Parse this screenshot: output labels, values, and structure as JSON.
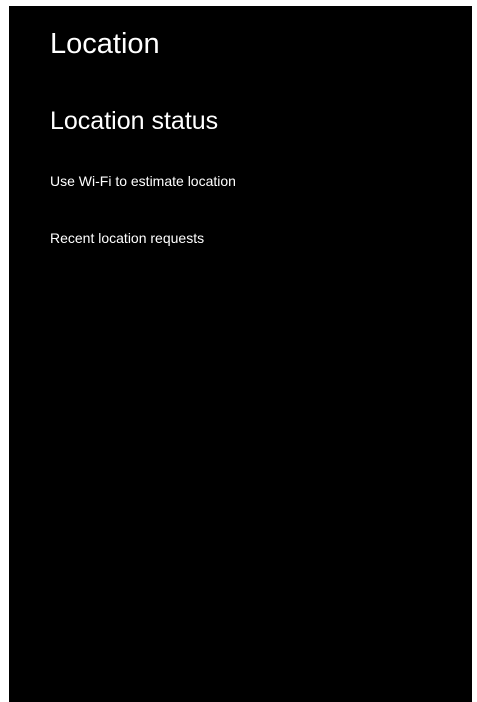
{
  "screen": {
    "title": "Location",
    "section_title": "Location status",
    "items": [
      {
        "label": "Use Wi-Fi to estimate location"
      },
      {
        "label": "Recent location requests"
      }
    ]
  },
  "colors": {
    "panel_background": "#000000",
    "text": "#ffffff",
    "outer_background": "#ffffff"
  }
}
